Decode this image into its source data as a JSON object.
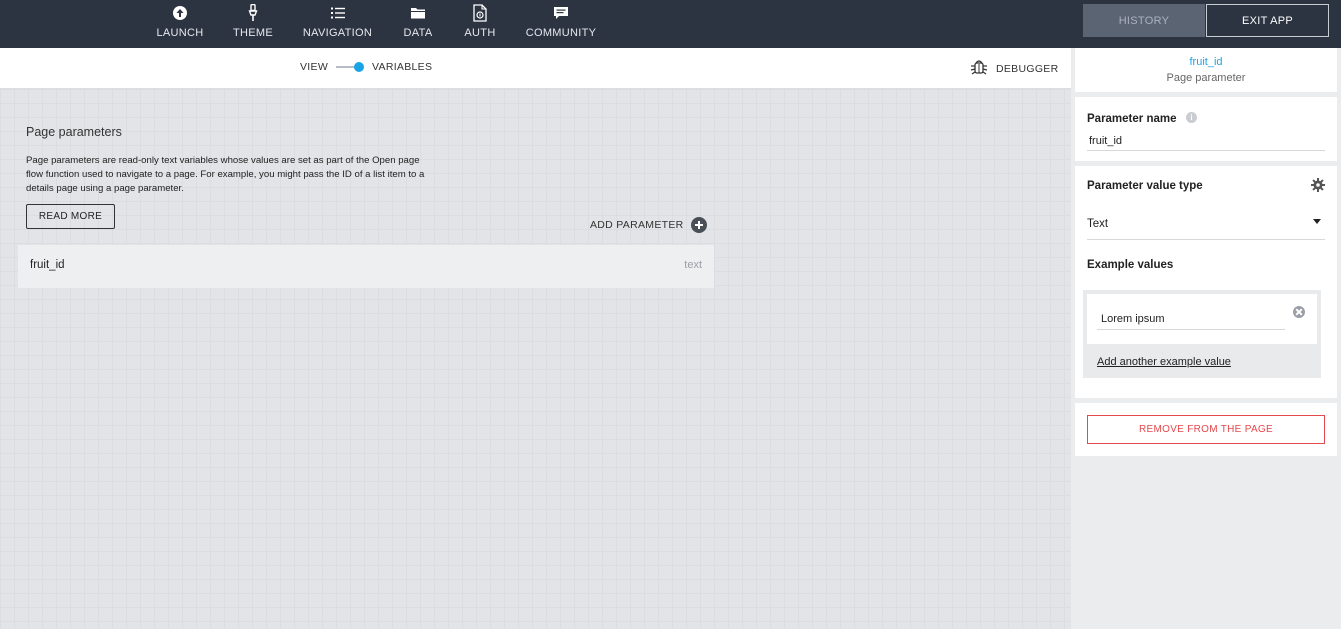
{
  "nav": {
    "items": [
      {
        "label": "LAUNCH",
        "icon": "upload-circle-icon"
      },
      {
        "label": "THEME",
        "icon": "paintbrush-icon"
      },
      {
        "label": "NAVIGATION",
        "icon": "list-icon"
      },
      {
        "label": "DATA",
        "icon": "folder-icon"
      },
      {
        "label": "AUTH",
        "icon": "file-lock-icon"
      },
      {
        "label": "COMMUNITY",
        "icon": "chat-icon"
      }
    ],
    "history_label": "HISTORY",
    "exit_label": "EXIT APP"
  },
  "toolbar": {
    "view_label": "VIEW",
    "variables_label": "VARIABLES",
    "debugger_label": "DEBUGGER"
  },
  "main": {
    "title": "Page parameters",
    "description": "Page parameters are read-only text variables whose values are set as part of the Open page flow function used to navigate to a page. For example, you might pass the ID of a list item to a details page using a page parameter.",
    "read_more_label": "READ MORE",
    "add_parameter_label": "ADD PARAMETER",
    "parameters": [
      {
        "name": "fruit_id",
        "type": "text"
      }
    ]
  },
  "panel": {
    "header_id": "fruit_id",
    "header_subtitle": "Page parameter",
    "name_label": "Parameter name",
    "name_value": "fruit_id",
    "value_type_label": "Parameter value type",
    "value_type": "Text",
    "example_values_label": "Example values",
    "example_values": [
      "Lorem ipsum"
    ],
    "add_example_label": "Add another example value",
    "remove_label": "REMOVE FROM THE PAGE"
  },
  "colors": {
    "topbar": "#2c3442",
    "accent": "#1aa3e6",
    "danger": "#e5484d"
  }
}
